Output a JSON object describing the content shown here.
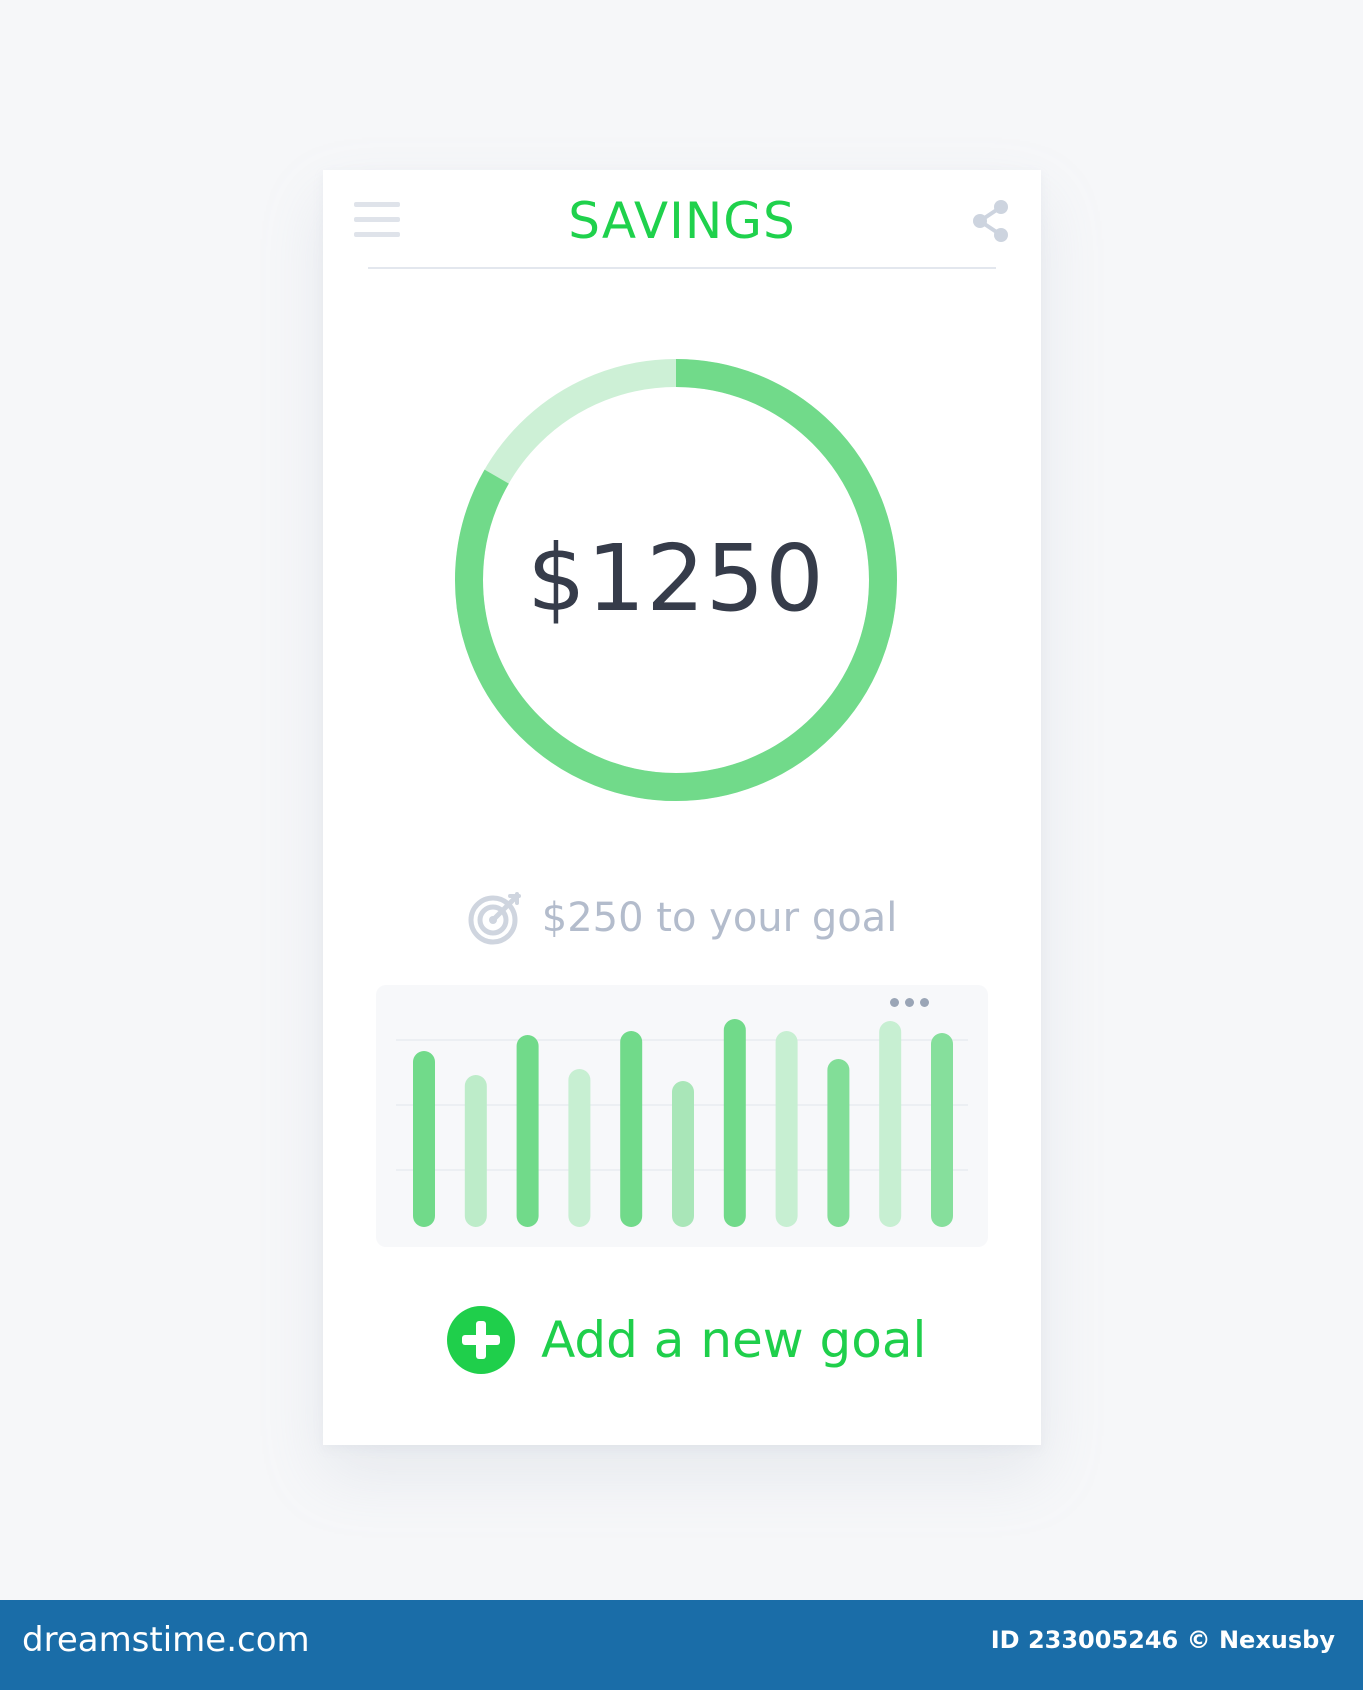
{
  "header": {
    "title": "SAVINGS",
    "menu_icon": "hamburger-menu-icon",
    "share_icon": "share-icon"
  },
  "savings": {
    "balance": "$1250",
    "progress_fraction": 0.833,
    "goal_text": "$250 to your goal",
    "goal_icon": "target-icon"
  },
  "chart_data": {
    "type": "bar",
    "title": "",
    "xlabel": "",
    "ylabel": "",
    "ylim": [
      0,
      1
    ],
    "categories": [
      "",
      "",
      "",
      "",
      "",
      "",
      "",
      "",
      "",
      "",
      ""
    ],
    "values": [
      0.88,
      0.76,
      0.96,
      0.79,
      0.98,
      0.73,
      1.04,
      0.98,
      0.84,
      1.03,
      0.97
    ],
    "bar_colors": [
      "#71da8a",
      "#bdecc9",
      "#71da8a",
      "#c7efd2",
      "#71da8a",
      "#a9e6b8",
      "#71da8a",
      "#c7efd2",
      "#82de98",
      "#c7efd2",
      "#86df9c"
    ],
    "grid": true,
    "more_icon": "more-dots-icon"
  },
  "actions": {
    "add_goal_label": "Add a new goal",
    "add_goal_icon": "plus-circle-icon"
  },
  "colors": {
    "accent": "#1fd14c",
    "ring_progress": "#71da8a",
    "ring_track": "#cdf0d6",
    "text_dark": "#363c4a",
    "text_muted": "#b3bccc"
  },
  "footer": {
    "brand": "dreamstime.com",
    "credit": "ID 233005246 © Nexusby"
  }
}
